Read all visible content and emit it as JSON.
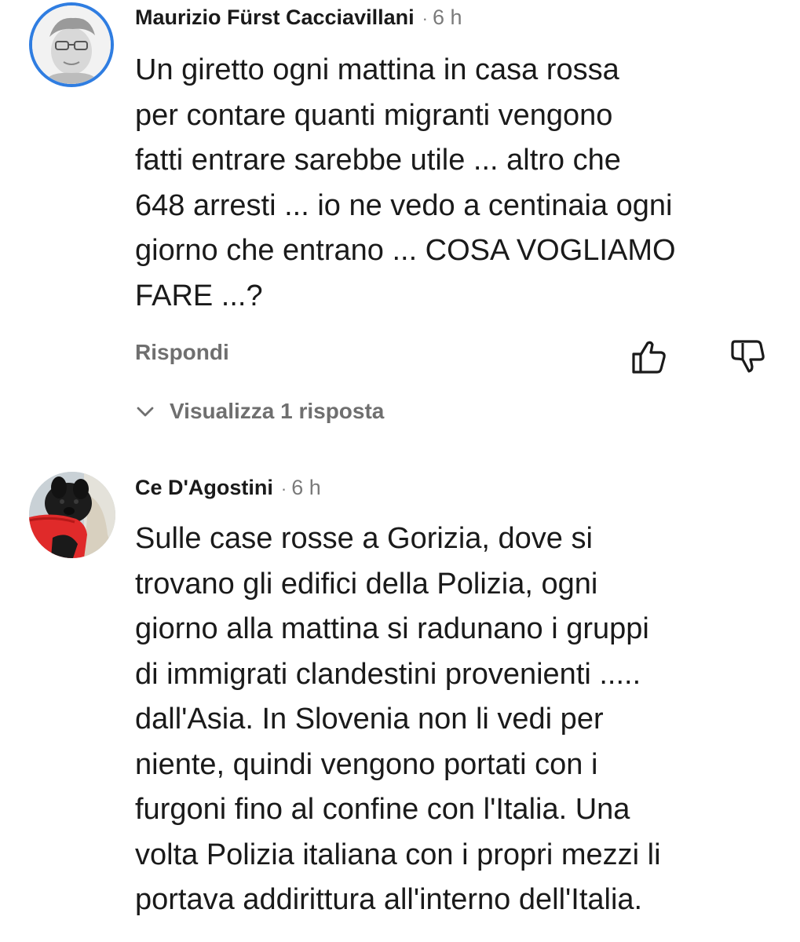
{
  "comments": [
    {
      "author": "Maurizio Fürst Cacciavillani",
      "separator": "·",
      "time": "6 h",
      "lines": [
        "Un giretto ogni mattina in casa rossa",
        "per contare quanti migranti vengono",
        "fatti entrare sarebbe utile ... altro che",
        "648 arresti ... io ne vedo a centinaia ogni",
        "giorno che entrano ... COSA VOGLIAMO",
        "FARE ...?"
      ],
      "reply_label": "Rispondi",
      "like_icon": "thumbs-up-icon",
      "dislike_icon": "thumbs-down-icon",
      "view_replies_label": "Visualizza 1 risposta",
      "avatar_ring_color": "#2f7de1"
    },
    {
      "author": "Ce D'Agostini",
      "separator": "·",
      "time": "6 h",
      "lines": [
        "Sulle case rosse a Gorizia, dove si",
        "trovano gli edifici della Polizia, ogni",
        "giorno alla mattina si radunano i gruppi",
        "di immigrati clandestini provenienti .....",
        "dall'Asia. In Slovenia non li vedi per",
        "niente, quindi vengono portati con i",
        "furgoni fino al confine con l'Italia. Una",
        "volta Polizia italiana con i propri mezzi li",
        "portava addirittura all'interno dell'Italia."
      ]
    }
  ],
  "colors": {
    "text": "#1a1a1a",
    "muted": "#6f6f6f",
    "ring": "#2f7de1"
  }
}
